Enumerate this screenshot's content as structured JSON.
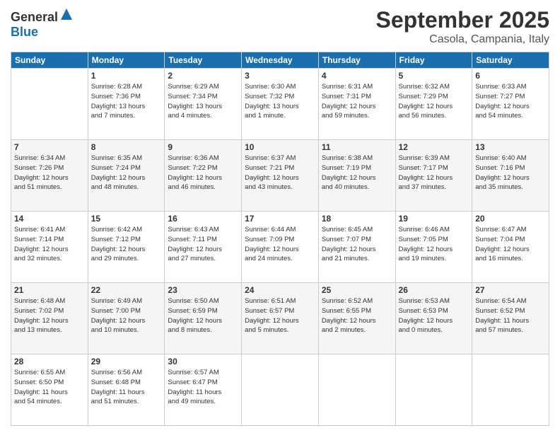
{
  "logo": {
    "general": "General",
    "blue": "Blue"
  },
  "header": {
    "month": "September 2025",
    "location": "Casola, Campania, Italy"
  },
  "days_of_week": [
    "Sunday",
    "Monday",
    "Tuesday",
    "Wednesday",
    "Thursday",
    "Friday",
    "Saturday"
  ],
  "weeks": [
    [
      {
        "day": "",
        "info": ""
      },
      {
        "day": "1",
        "info": "Sunrise: 6:28 AM\nSunset: 7:36 PM\nDaylight: 13 hours\nand 7 minutes."
      },
      {
        "day": "2",
        "info": "Sunrise: 6:29 AM\nSunset: 7:34 PM\nDaylight: 13 hours\nand 4 minutes."
      },
      {
        "day": "3",
        "info": "Sunrise: 6:30 AM\nSunset: 7:32 PM\nDaylight: 13 hours\nand 1 minute."
      },
      {
        "day": "4",
        "info": "Sunrise: 6:31 AM\nSunset: 7:31 PM\nDaylight: 12 hours\nand 59 minutes."
      },
      {
        "day": "5",
        "info": "Sunrise: 6:32 AM\nSunset: 7:29 PM\nDaylight: 12 hours\nand 56 minutes."
      },
      {
        "day": "6",
        "info": "Sunrise: 6:33 AM\nSunset: 7:27 PM\nDaylight: 12 hours\nand 54 minutes."
      }
    ],
    [
      {
        "day": "7",
        "info": "Sunrise: 6:34 AM\nSunset: 7:26 PM\nDaylight: 12 hours\nand 51 minutes."
      },
      {
        "day": "8",
        "info": "Sunrise: 6:35 AM\nSunset: 7:24 PM\nDaylight: 12 hours\nand 48 minutes."
      },
      {
        "day": "9",
        "info": "Sunrise: 6:36 AM\nSunset: 7:22 PM\nDaylight: 12 hours\nand 46 minutes."
      },
      {
        "day": "10",
        "info": "Sunrise: 6:37 AM\nSunset: 7:21 PM\nDaylight: 12 hours\nand 43 minutes."
      },
      {
        "day": "11",
        "info": "Sunrise: 6:38 AM\nSunset: 7:19 PM\nDaylight: 12 hours\nand 40 minutes."
      },
      {
        "day": "12",
        "info": "Sunrise: 6:39 AM\nSunset: 7:17 PM\nDaylight: 12 hours\nand 37 minutes."
      },
      {
        "day": "13",
        "info": "Sunrise: 6:40 AM\nSunset: 7:16 PM\nDaylight: 12 hours\nand 35 minutes."
      }
    ],
    [
      {
        "day": "14",
        "info": "Sunrise: 6:41 AM\nSunset: 7:14 PM\nDaylight: 12 hours\nand 32 minutes."
      },
      {
        "day": "15",
        "info": "Sunrise: 6:42 AM\nSunset: 7:12 PM\nDaylight: 12 hours\nand 29 minutes."
      },
      {
        "day": "16",
        "info": "Sunrise: 6:43 AM\nSunset: 7:11 PM\nDaylight: 12 hours\nand 27 minutes."
      },
      {
        "day": "17",
        "info": "Sunrise: 6:44 AM\nSunset: 7:09 PM\nDaylight: 12 hours\nand 24 minutes."
      },
      {
        "day": "18",
        "info": "Sunrise: 6:45 AM\nSunset: 7:07 PM\nDaylight: 12 hours\nand 21 minutes."
      },
      {
        "day": "19",
        "info": "Sunrise: 6:46 AM\nSunset: 7:05 PM\nDaylight: 12 hours\nand 19 minutes."
      },
      {
        "day": "20",
        "info": "Sunrise: 6:47 AM\nSunset: 7:04 PM\nDaylight: 12 hours\nand 16 minutes."
      }
    ],
    [
      {
        "day": "21",
        "info": "Sunrise: 6:48 AM\nSunset: 7:02 PM\nDaylight: 12 hours\nand 13 minutes."
      },
      {
        "day": "22",
        "info": "Sunrise: 6:49 AM\nSunset: 7:00 PM\nDaylight: 12 hours\nand 10 minutes."
      },
      {
        "day": "23",
        "info": "Sunrise: 6:50 AM\nSunset: 6:59 PM\nDaylight: 12 hours\nand 8 minutes."
      },
      {
        "day": "24",
        "info": "Sunrise: 6:51 AM\nSunset: 6:57 PM\nDaylight: 12 hours\nand 5 minutes."
      },
      {
        "day": "25",
        "info": "Sunrise: 6:52 AM\nSunset: 6:55 PM\nDaylight: 12 hours\nand 2 minutes."
      },
      {
        "day": "26",
        "info": "Sunrise: 6:53 AM\nSunset: 6:53 PM\nDaylight: 12 hours\nand 0 minutes."
      },
      {
        "day": "27",
        "info": "Sunrise: 6:54 AM\nSunset: 6:52 PM\nDaylight: 11 hours\nand 57 minutes."
      }
    ],
    [
      {
        "day": "28",
        "info": "Sunrise: 6:55 AM\nSunset: 6:50 PM\nDaylight: 11 hours\nand 54 minutes."
      },
      {
        "day": "29",
        "info": "Sunrise: 6:56 AM\nSunset: 6:48 PM\nDaylight: 11 hours\nand 51 minutes."
      },
      {
        "day": "30",
        "info": "Sunrise: 6:57 AM\nSunset: 6:47 PM\nDaylight: 11 hours\nand 49 minutes."
      },
      {
        "day": "",
        "info": ""
      },
      {
        "day": "",
        "info": ""
      },
      {
        "day": "",
        "info": ""
      },
      {
        "day": "",
        "info": ""
      }
    ]
  ]
}
